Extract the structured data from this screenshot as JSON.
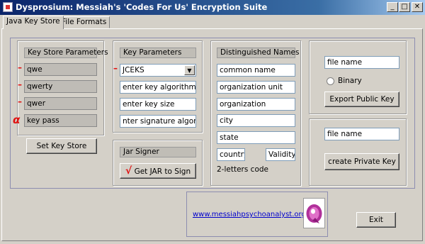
{
  "window": {
    "title": "Dysprosium: Messiah's 'Codes For Us' Encryption Suite",
    "min": "_",
    "max": "□",
    "close": "✕"
  },
  "tabs": [
    "Java Key Store",
    "File Formats"
  ],
  "keystore": {
    "header": "Key Store Parameters",
    "fields": [
      "qwe",
      "qwerty",
      "qwer",
      "key pass"
    ],
    "button": "Set Key Store"
  },
  "keyparams": {
    "header": "Key Parameters",
    "combo_value": "JCEKS",
    "fields": [
      "enter key algorithm",
      "enter key size",
      "nter signature algorithm"
    ]
  },
  "jarsigner": {
    "header": "Jar Signer",
    "button": "Get JAR to Sign",
    "check": "√"
  },
  "dn": {
    "header": "Distinguished Names",
    "fields": [
      "common name",
      "organization unit",
      "organization",
      "city",
      "state"
    ],
    "country": "country",
    "validity": "Validity",
    "note": "2-letters code"
  },
  "public": {
    "file": "file name",
    "radio": "Binary",
    "button": "Export Public Key"
  },
  "private": {
    "file": "file name",
    "button": "create Private Key"
  },
  "footer": {
    "link": "www.messiahpsychoanalyst.org",
    "exit": "Exit"
  },
  "colors": {
    "annotation_red": "#e01010",
    "link": "#0000cc",
    "titlebar": "#0a246a"
  }
}
